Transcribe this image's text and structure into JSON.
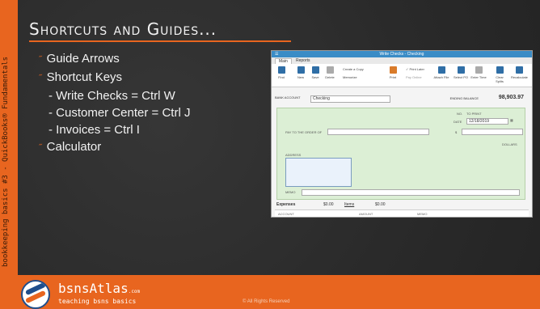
{
  "sidebar": {
    "text": "bookkeeping basics #3 - QuickBooks® Fundamentals"
  },
  "title": "Shortcuts and Guides...",
  "bullets": [
    {
      "mark": "˝",
      "text": "Guide Arrows"
    },
    {
      "mark": "˝",
      "text": "Shortcut Keys"
    },
    {
      "mark": "",
      "text": "- Write Checks = Ctrl W"
    },
    {
      "mark": "",
      "text": "- Customer Center = Ctrl J"
    },
    {
      "mark": "",
      "text": "- Invoices = Ctrl I"
    },
    {
      "mark": "˝",
      "text": "Calculator"
    }
  ],
  "footer": {
    "brand": "bsnsAtlas",
    "brand_suffix": ".com",
    "tagline": "teaching bsns basics",
    "copyright": "© All Rights Reserved"
  },
  "window": {
    "title": "Write Checks - Checking",
    "tabs": [
      "Main",
      "Reports"
    ],
    "ribbon": [
      {
        "label": "Find",
        "icon": "arrows-icon"
      },
      {
        "label": "New",
        "icon": "new-icon"
      },
      {
        "label": "Save",
        "icon": "save-icon"
      },
      {
        "label": "Delete",
        "icon": "delete-icon"
      },
      {
        "label": "Memorize",
        "icon": "memorize-icon"
      },
      {
        "label": "Print",
        "icon": "print-icon"
      },
      {
        "label": "Attach File",
        "icon": "attach-icon"
      },
      {
        "label": "Select PO",
        "icon": "select-po-icon"
      },
      {
        "label": "Enter Time",
        "icon": "clock-icon"
      },
      {
        "label": "Clear Splits",
        "icon": "clear-icon"
      },
      {
        "label": "Recalculate",
        "icon": "calculator-icon"
      }
    ],
    "create_copy": "Create a Copy",
    "print_later": "Print Later",
    "pay_online": "Pay Online",
    "bank_account_label": "BANK ACCOUNT",
    "bank_account": "Checking",
    "ending_balance_label": "ENDING BALANCE",
    "ending_balance": "98,903.97",
    "no_label": "NO.",
    "no_value": "TO PRINT",
    "date_label": "DATE",
    "date_value": "12/18/2019",
    "pay_to_label": "PAY TO THE ORDER OF",
    "dollar_sign": "$",
    "dollars_label": "DOLLARS",
    "address_label": "ADDRESS",
    "memo_label": "MEMO",
    "expenses_label": "Expenses",
    "expenses_amount": "$0.00",
    "items_label": "Items",
    "items_amount": "$0.00",
    "columns": [
      "ACCOUNT",
      "AMOUNT",
      "MEMO"
    ]
  }
}
